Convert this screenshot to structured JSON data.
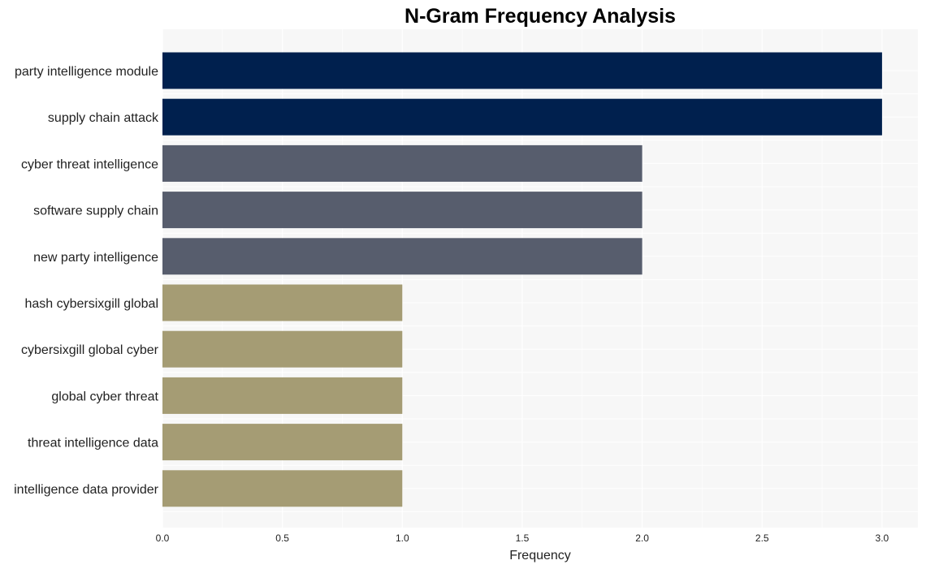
{
  "chart_data": {
    "type": "bar",
    "orientation": "horizontal",
    "title": "N-Gram Frequency Analysis",
    "xlabel": "Frequency",
    "ylabel": "",
    "xlim": [
      0,
      3.15
    ],
    "grid": true,
    "legend": "none",
    "xticks": [
      "0.0",
      "0.5",
      "1.0",
      "1.5",
      "2.0",
      "2.5",
      "3.0"
    ],
    "xtick_values": [
      0,
      0.5,
      1.0,
      1.5,
      2.0,
      2.5,
      3.0
    ],
    "categories": [
      "party intelligence module",
      "supply chain attack",
      "cyber threat intelligence",
      "software supply chain",
      "new party intelligence",
      "hash cybersixgill global",
      "cybersixgill global cyber",
      "global cyber threat",
      "threat intelligence data",
      "intelligence data provider"
    ],
    "values": [
      3,
      3,
      2,
      2,
      2,
      1,
      1,
      1,
      1,
      1
    ],
    "colors": {
      "3": "#00204e",
      "2": "#575d6d",
      "1": "#a59c74"
    },
    "background": "#f7f7f7",
    "gridcolor": "#ffffff"
  }
}
